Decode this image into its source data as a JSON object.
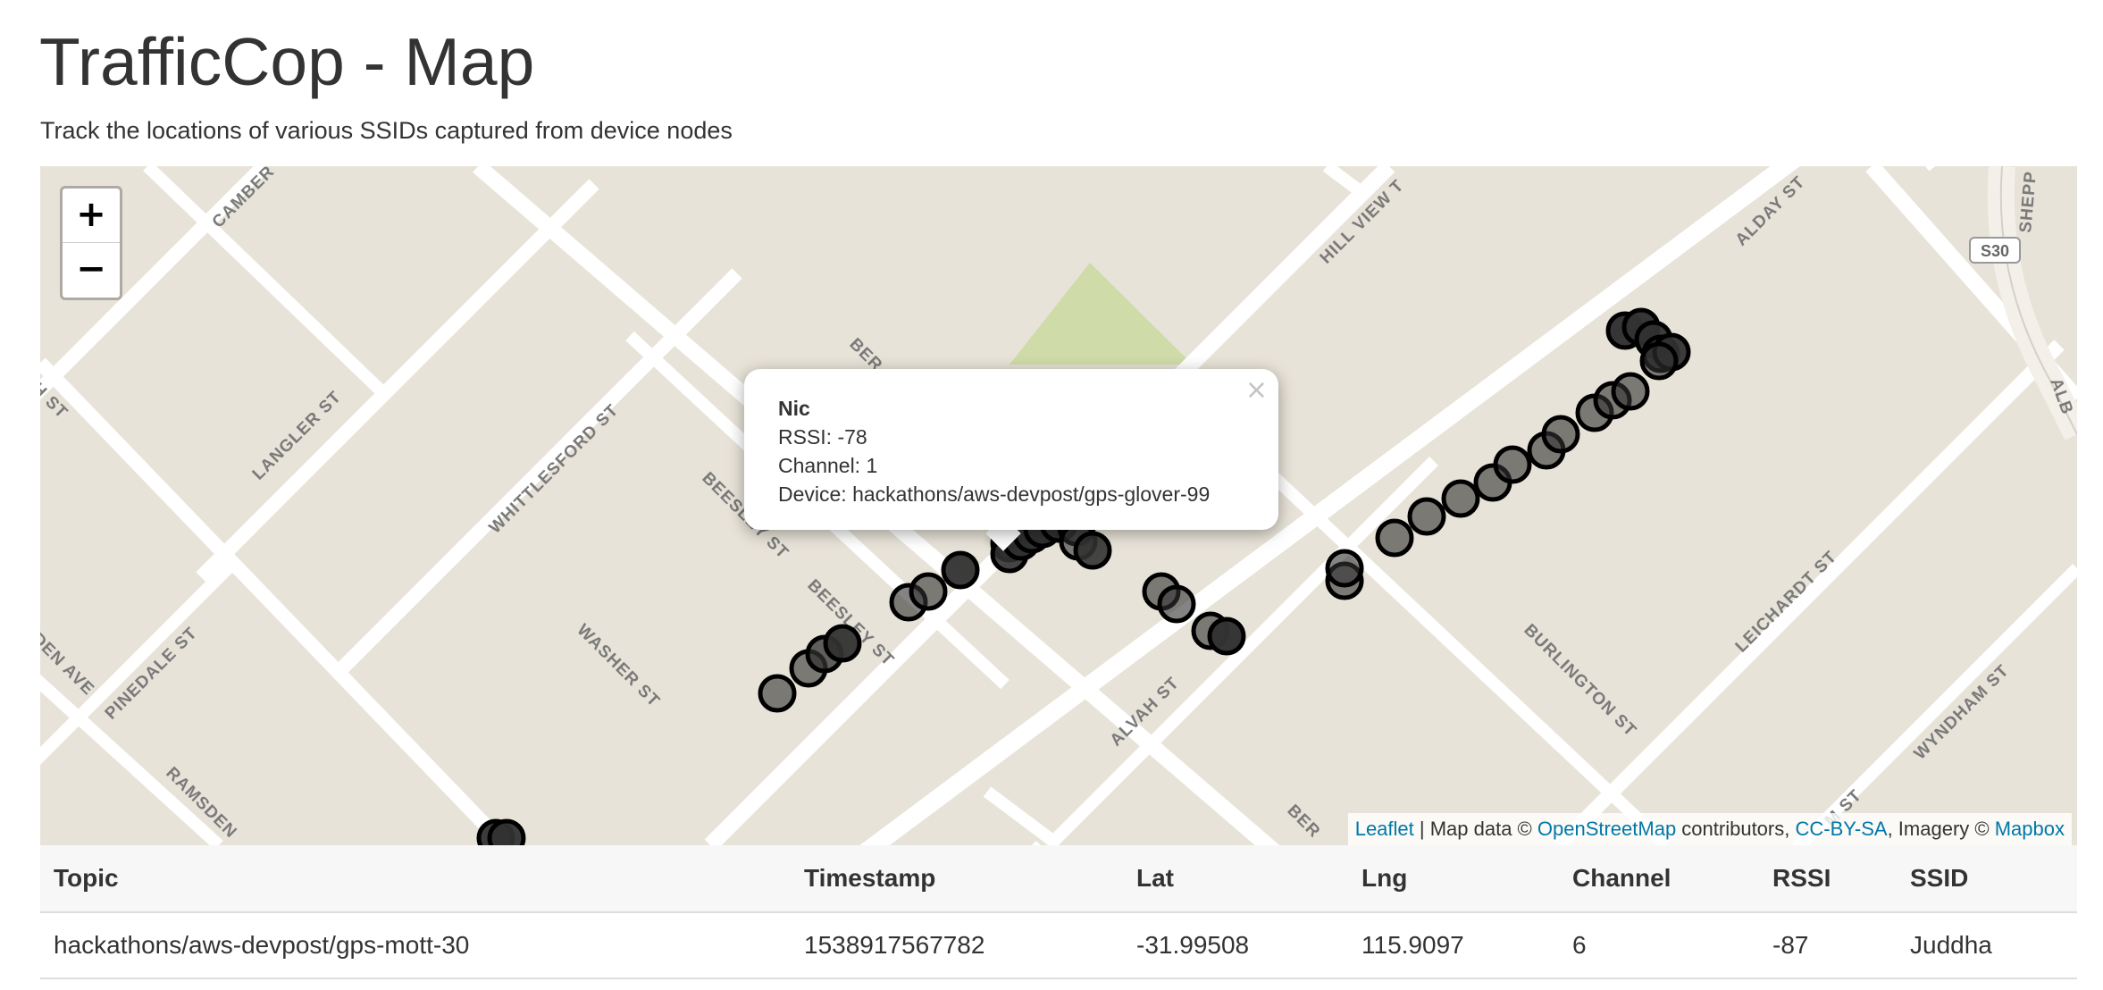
{
  "header": {
    "title": "TrafficCop - Map",
    "subtitle": "Track the locations of various SSIDs captured from device nodes"
  },
  "map": {
    "zoom_in_label": "+",
    "zoom_out_label": "−",
    "street_labels": [
      "CAMBER",
      "LANGLER ST",
      "WHITTLESFORD ST",
      "BEESLEY ST",
      "BEESLEY ST",
      "WASHER ST",
      "PINEDALE ST",
      "RAMSDEN",
      "DEN AVE",
      "H ST",
      "BER",
      "BER",
      "HILL VIEW T",
      "ALDAY ST",
      "ALVAH ST",
      "BURLINGTON ST",
      "LEICHARDT ST",
      "WYNDHAM ST",
      "M ST",
      "SHEPP",
      "ALB"
    ],
    "route_shield": "S30",
    "popup": {
      "name": "Nic",
      "rssi_line": "RSSI: -78",
      "channel_line": "Channel: 1",
      "device_line": "Device: hackathons/aws-devpost/gps-glover-99",
      "close_label": "×"
    },
    "attribution": {
      "leaflet": "Leaflet",
      "text1": " | Map data © ",
      "osm": "OpenStreetMap",
      "text2": " contributors, ",
      "license": "CC-BY-SA",
      "text3": ", Imagery © ",
      "mapbox": "Mapbox"
    }
  },
  "table": {
    "headers": [
      "Topic",
      "Timestamp",
      "Lat",
      "Lng",
      "Channel",
      "RSSI",
      "SSID"
    ],
    "rows": [
      [
        "hackathons/aws-devpost/gps-mott-30",
        "1538917567782",
        "-31.99508",
        "115.9097",
        "6",
        "-87",
        "Juddha"
      ]
    ]
  },
  "colors": {
    "land": "#e8e3d8",
    "road": "#ffffff",
    "park": "#cfdba8",
    "link": "#0078a8",
    "marker_stroke": "#000000"
  }
}
